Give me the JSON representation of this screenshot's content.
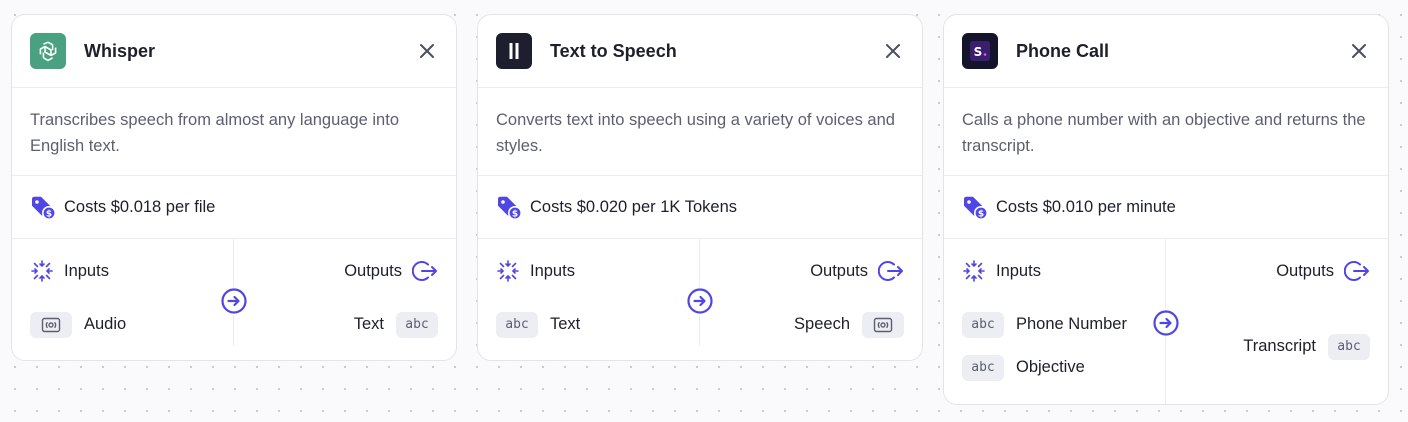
{
  "colors": {
    "accent": "#4f46e5",
    "openai_green": "#4aa181",
    "elevenlabs_dark": "#1e1f2e",
    "phone_dark": "#14142a"
  },
  "nodes": [
    {
      "icon": "openai-logo-icon",
      "title": "Whisper",
      "description": "Transcribes speech from almost any language into English text.",
      "cost": "Costs $0.018 per file",
      "inputs_label": "Inputs",
      "outputs_label": "Outputs",
      "inputs": [
        {
          "type_icon": "audio-type-icon",
          "label": "Audio"
        }
      ],
      "outputs": [
        {
          "type_chip": "abc",
          "label": "Text"
        }
      ]
    },
    {
      "icon": "elevenlabs-logo-icon",
      "title": "Text to Speech",
      "description": "Converts text into speech using a variety of voices and styles.",
      "cost": "Costs $0.020 per 1K Tokens",
      "inputs_label": "Inputs",
      "outputs_label": "Outputs",
      "inputs": [
        {
          "type_chip": "abc",
          "label": "Text"
        }
      ],
      "outputs": [
        {
          "type_icon": "audio-type-icon",
          "label": "Speech"
        }
      ]
    },
    {
      "icon": "phone-app-logo-icon",
      "title": "Phone Call",
      "description": "Calls a phone number with an objective and returns the transcript.",
      "cost": "Costs $0.010 per minute",
      "inputs_label": "Inputs",
      "outputs_label": "Outputs",
      "inputs": [
        {
          "type_chip": "abc",
          "label": "Phone Number"
        },
        {
          "type_chip": "abc",
          "label": "Objective"
        }
      ],
      "outputs": [
        {
          "type_chip": "abc",
          "label": "Transcript"
        }
      ]
    }
  ]
}
